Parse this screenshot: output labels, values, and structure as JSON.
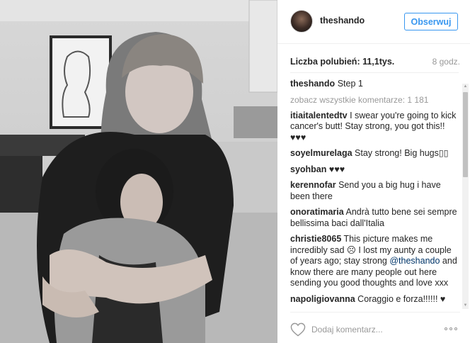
{
  "post": {
    "username": "theshando",
    "follow_label": "Obserwuj",
    "likes": "Liczba polubień: 11,1tys.",
    "time": "8 godz.",
    "caption": {
      "user": "theshando",
      "text": "Step 1"
    },
    "view_all": "zobacz wszystkie komentarze: 1 181",
    "comments": [
      {
        "user": "itiaitalentedtv",
        "text": "I swear you're going to kick cancer's butt! Stay strong, you got this!! ♥♥♥"
      },
      {
        "user": "soyelmurelaga",
        "text": "Stay strong! Big hugs▯▯"
      },
      {
        "user": "syohban",
        "text": "♥♥♥"
      },
      {
        "user": "kerennofar",
        "text": "Send you a big hug i have been there"
      },
      {
        "user": "onoratimaria",
        "text": "Andrà tutto bene sei sempre bellissima baci dall'Italia"
      },
      {
        "user": "christie8065",
        "text_before": "This picture makes me incredibly sad ☹ I lost my aunty a couple of years ago; stay strong ",
        "mention": "@theshando",
        "text_after": " and know there are many people out here sending you good thoughts and love xxx"
      },
      {
        "user": "napoligiovanna",
        "text": "Coraggio e forza!!!!!! ♥"
      }
    ],
    "comment_placeholder": "Dodaj komentarz..."
  },
  "icons": {
    "heart": "heart-icon",
    "more": "more-options-icon"
  },
  "colors": {
    "accent": "#3897f0",
    "muted": "#999999",
    "text": "#262626"
  }
}
